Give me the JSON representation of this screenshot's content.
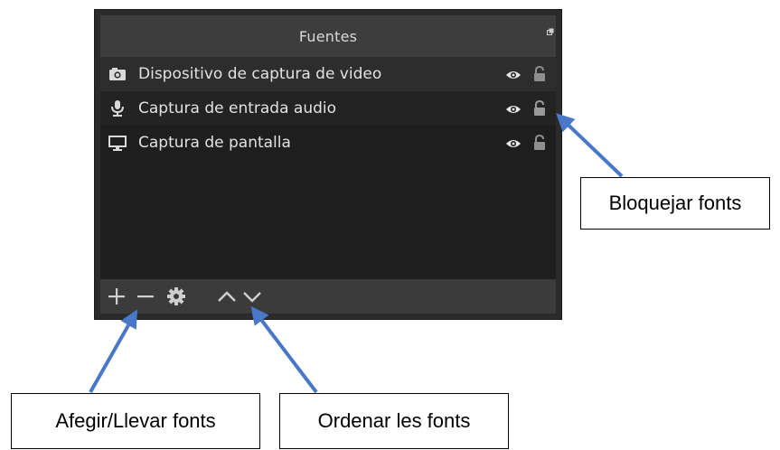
{
  "panel": {
    "title": "Fuentes",
    "sources": [
      {
        "label": "Dispositivo de captura de video",
        "icon": "camera-icon"
      },
      {
        "label": "Captura de entrada audio",
        "icon": "microphone-icon"
      },
      {
        "label": "Captura de pantalla",
        "icon": "monitor-icon"
      }
    ],
    "toolbar": [
      "add-icon",
      "remove-icon",
      "gear-icon",
      "arrow-up-icon",
      "arrow-down-icon"
    ]
  },
  "annotations": {
    "lock_sources": "Bloquejar fonts",
    "add_remove_sources": "Afegir/Llevar fonts",
    "order_sources": "Ordenar les fonts"
  },
  "colors": {
    "panel_bg": "#2b2b2b",
    "title_bar": "#3d3d3d",
    "list_bg": "#1e1e1e",
    "toolbar_bg": "#3b3b3b",
    "text": "#e2e2e2",
    "arrow": "#4a78c8"
  }
}
